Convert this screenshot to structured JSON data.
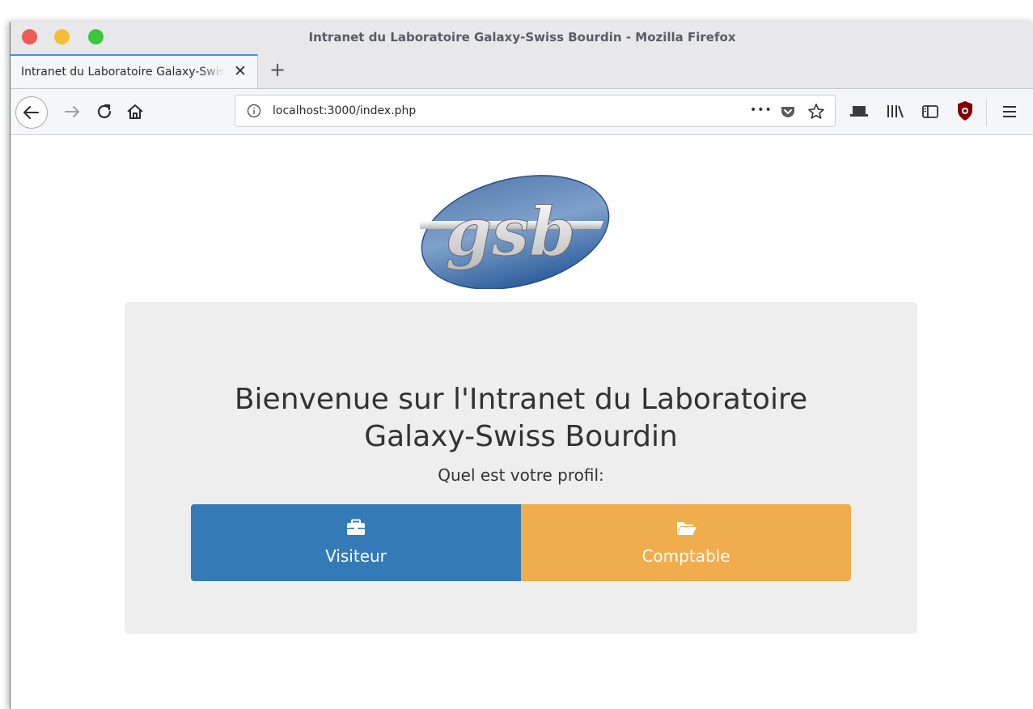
{
  "window": {
    "title": "Intranet du Laboratoire Galaxy-Swiss Bourdin - Mozilla Firefox"
  },
  "tab": {
    "title": "Intranet du Laboratoire Galaxy-Swiss Bourdin",
    "close_glyph": "✕",
    "new_tab_glyph": "+"
  },
  "navbar": {
    "url": "localhost:3000/index.php",
    "page_actions_glyph": "•••"
  },
  "logo": {
    "text": "gsb"
  },
  "welcome": {
    "line1": "Bienvenue sur l'Intranet du Laboratoire",
    "line2": "Galaxy-Swiss Bourdin",
    "prompt": "Quel est votre profil:"
  },
  "profiles": [
    {
      "label": "Visiteur",
      "icon": "briefcase-icon",
      "color": "#337ab7"
    },
    {
      "label": "Comptable",
      "icon": "folder-open-icon",
      "color": "#f0ad4e"
    }
  ]
}
